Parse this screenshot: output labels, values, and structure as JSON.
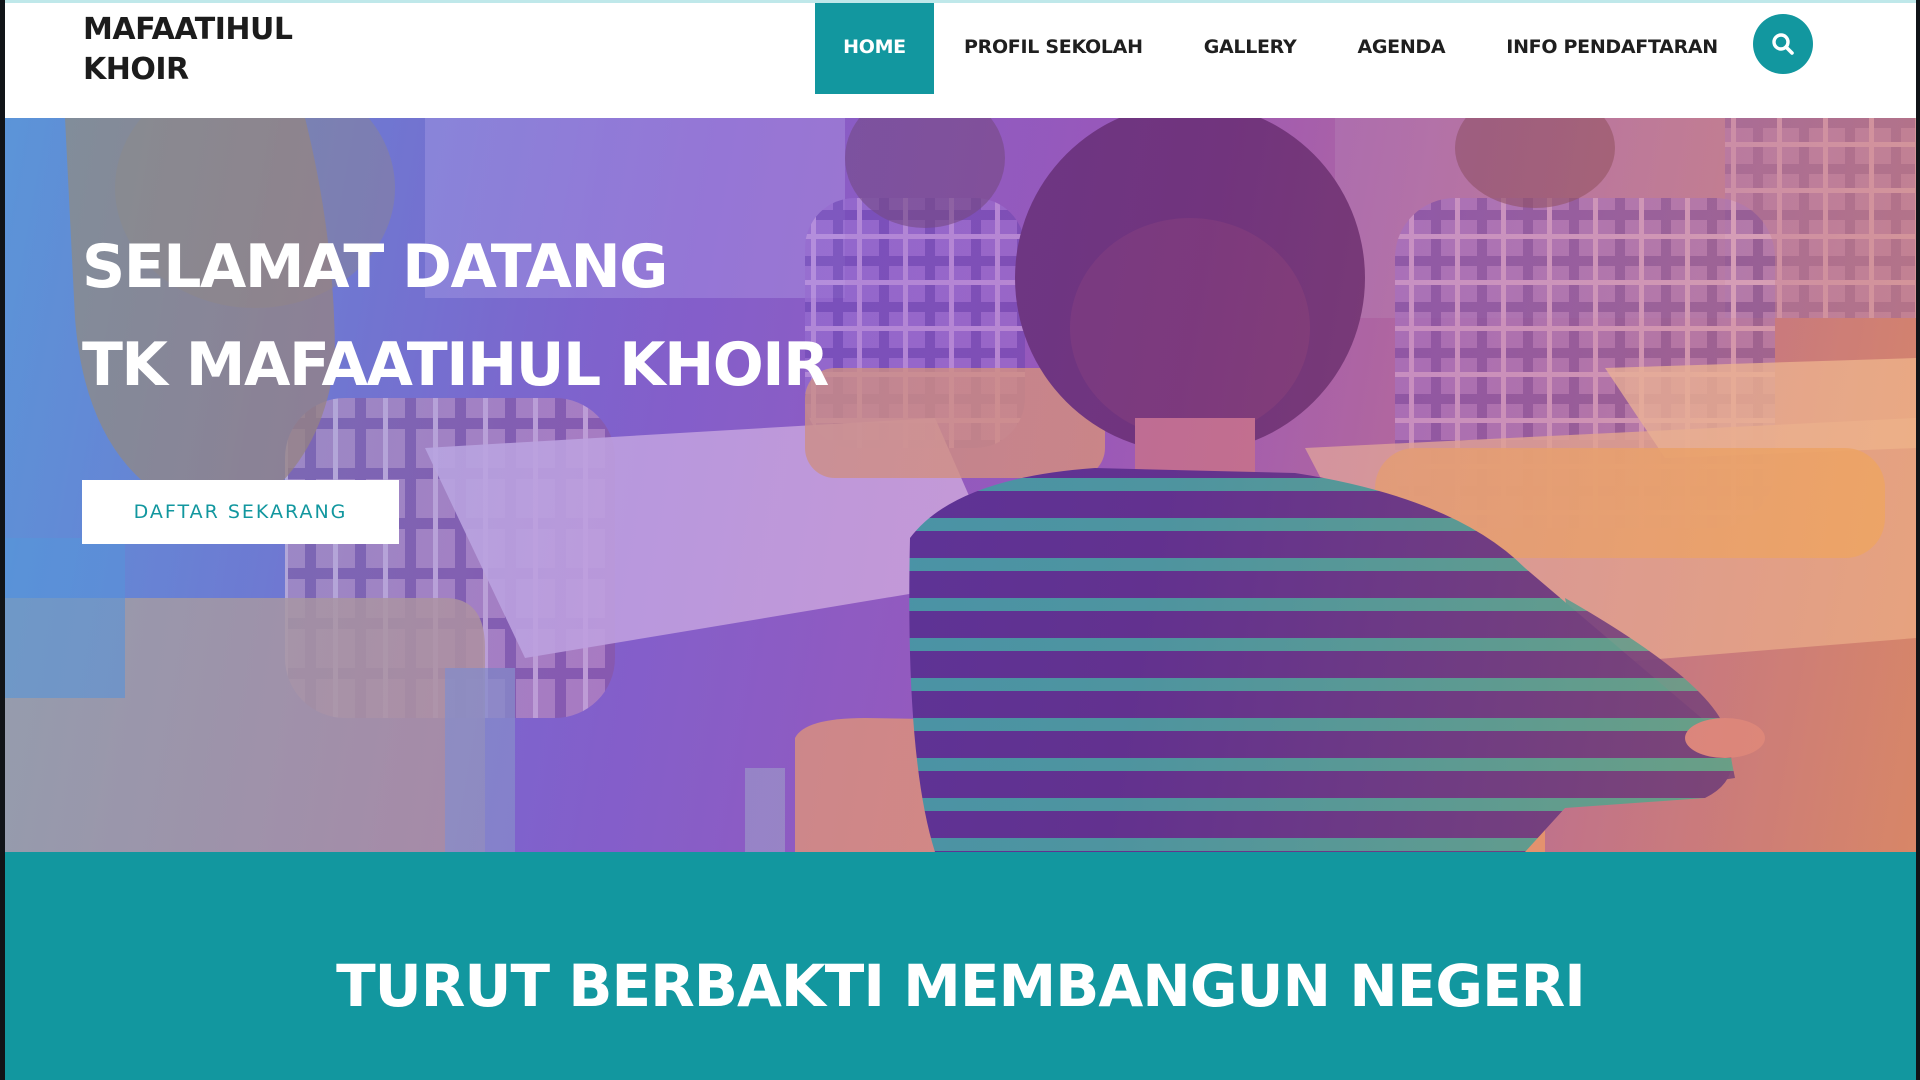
{
  "brand": {
    "line1": "MAFAATIHUL",
    "line2": "KHOIR"
  },
  "nav": {
    "items": [
      {
        "label": "HOME",
        "active": true
      },
      {
        "label": "PROFIL SEKOLAH",
        "active": false
      },
      {
        "label": "GALLERY",
        "active": false
      },
      {
        "label": "AGENDA",
        "active": false
      },
      {
        "label": "INFO PENDAFTARAN",
        "active": false
      }
    ],
    "search_icon": "search-icon"
  },
  "hero": {
    "title_line1": "SELAMAT DATANG",
    "title_line2": "TK MAFAATIHUL KHOIR",
    "cta_label": "DAFTAR SEKARANG"
  },
  "band": {
    "title": "TURUT BERBAKTI MEMBANGUN NEGERI"
  },
  "colors": {
    "accent": "#12979f",
    "text_dark": "#1f1f1f",
    "white": "#ffffff"
  }
}
